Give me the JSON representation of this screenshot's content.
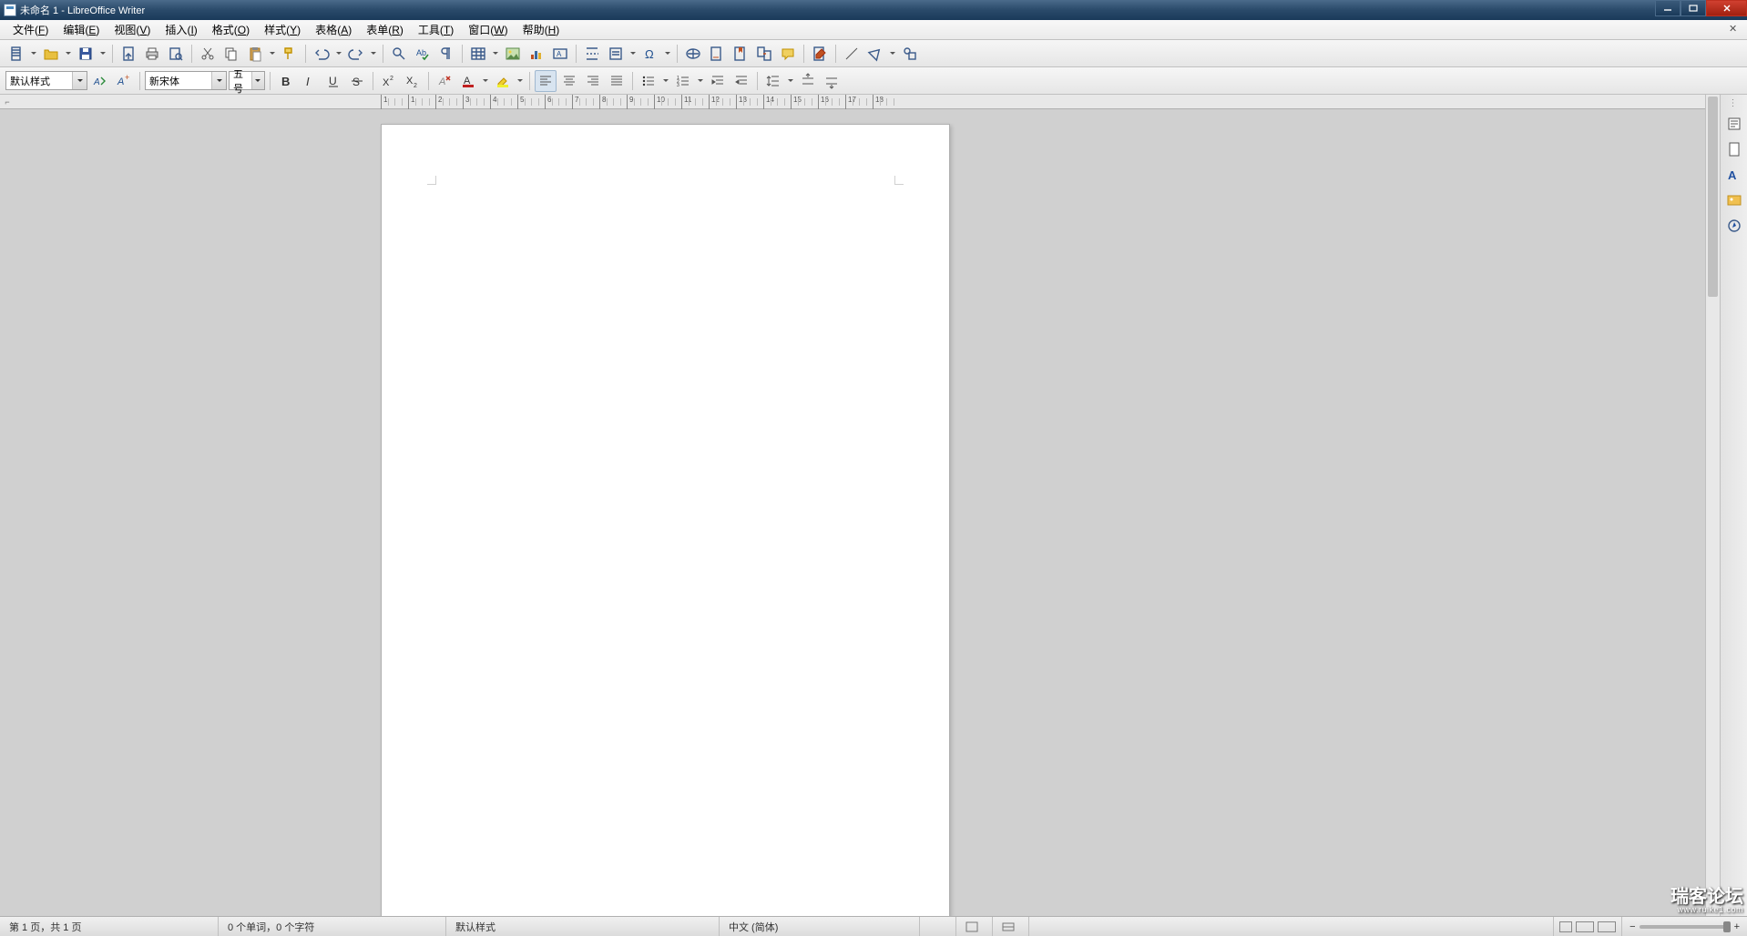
{
  "window": {
    "title": "未命名 1 - LibreOffice Writer"
  },
  "menu": {
    "file": {
      "label": "文件",
      "hotkey": "F"
    },
    "edit": {
      "label": "编辑",
      "hotkey": "E"
    },
    "view": {
      "label": "视图",
      "hotkey": "V"
    },
    "insert": {
      "label": "插入",
      "hotkey": "I"
    },
    "format": {
      "label": "格式",
      "hotkey": "O"
    },
    "styles": {
      "label": "样式",
      "hotkey": "Y"
    },
    "table": {
      "label": "表格",
      "hotkey": "A"
    },
    "form": {
      "label": "表单",
      "hotkey": "R"
    },
    "tools": {
      "label": "工具",
      "hotkey": "T"
    },
    "window": {
      "label": "窗口",
      "hotkey": "W"
    },
    "help": {
      "label": "帮助",
      "hotkey": "H"
    }
  },
  "formatting": {
    "paragraph_style": "默认样式",
    "font_name": "新宋体",
    "font_size": "五号"
  },
  "ruler": {
    "labels": [
      "1",
      "1",
      "2",
      "3",
      "4",
      "5",
      "6",
      "7",
      "8",
      "9",
      "10",
      "11",
      "12",
      "13",
      "14",
      "15",
      "16",
      "17",
      "18"
    ]
  },
  "status": {
    "page": "第 1 页，共 1 页",
    "words": "0 个单词，0 个字符",
    "style": "默认样式",
    "language": "中文 (简体)"
  },
  "watermark": {
    "main": "瑞客论坛",
    "sub": "www.ruike1.com"
  }
}
